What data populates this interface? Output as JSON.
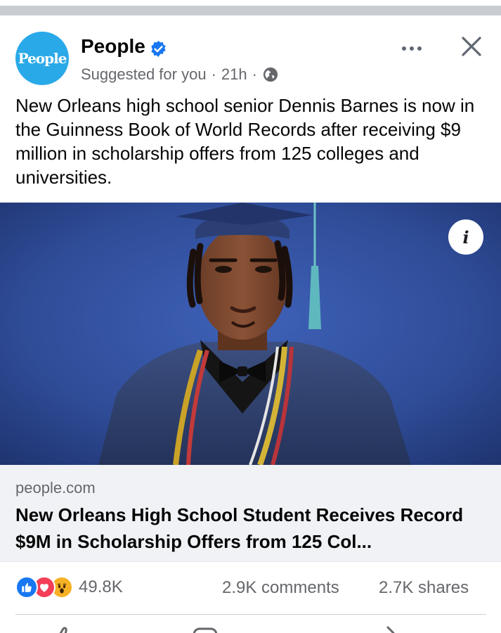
{
  "post": {
    "page_name": "People",
    "avatar_text": "People",
    "suggested": "Suggested for you",
    "time": "21h",
    "separator": "·",
    "body": "New Orleans high school senior Dennis Barnes is now in the Guinness Book of World Records after receiving $9 million in scholarship offers from 125 colleges and universities."
  },
  "link": {
    "domain": "people.com",
    "headline": "New Orleans High School Student Receives Record $9M in Scholarship Offers from 125 Col..."
  },
  "stats": {
    "reactions": "49.8K",
    "comments": "2.9K comments",
    "shares": "2.7K shares"
  },
  "icons": {
    "verified": "verified-badge-icon",
    "globe": "globe-icon",
    "more": "more-options-icon",
    "close": "close-icon",
    "info": "info-icon",
    "reactions": [
      "like-icon",
      "love-icon",
      "wow-icon"
    ],
    "actions": [
      "like-action-icon",
      "comment-action-icon",
      "share-action-icon"
    ]
  },
  "colors": {
    "brand": "#1877f2",
    "avatar": "#2aa9e8",
    "love": "#f33e58",
    "wow": "#f7b125",
    "secondary_text": "#65676b",
    "link_bg": "#f0f2f5"
  }
}
